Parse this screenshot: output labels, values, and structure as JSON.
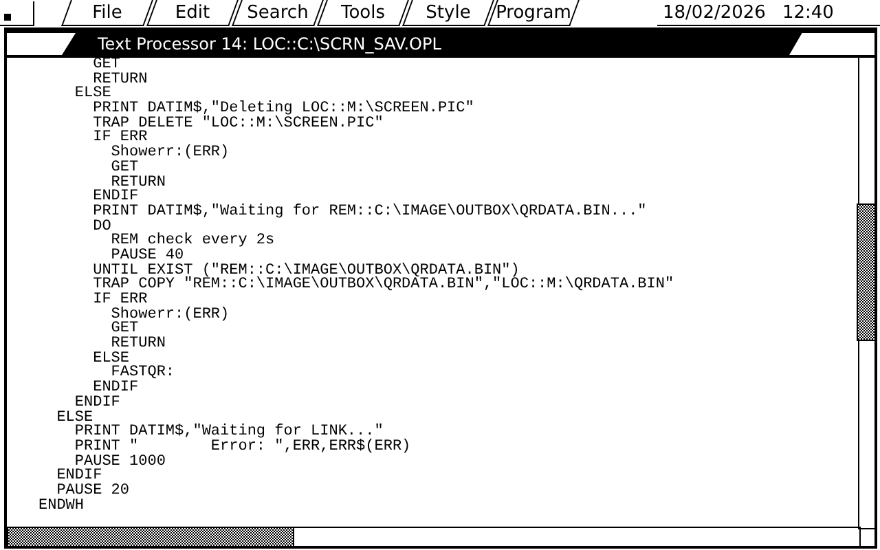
{
  "menu_bar": {
    "items": [
      "File",
      "Edit",
      "Search",
      "Tools",
      "Style",
      "Program"
    ]
  },
  "clock": {
    "date": "18/02/2026",
    "time": "12:40"
  },
  "window": {
    "title": "Text Processor 14: LOC::C:\\SCRN_SAV.OPL"
  },
  "editor": {
    "lines": [
      "      GET",
      "      RETURN",
      "    ELSE",
      "      PRINT DATIM$,\"Deleting LOC::M:\\SCREEN.PIC\"",
      "      TRAP DELETE \"LOC::M:\\SCREEN.PIC\"",
      "      IF ERR",
      "        Showerr:(ERR)",
      "        GET",
      "        RETURN",
      "      ENDIF",
      "      PRINT DATIM$,\"Waiting for REM::C:\\IMAGE\\OUTBOX\\QRDATA.BIN...\"",
      "      DO",
      "        REM check every 2s",
      "        PAUSE 40",
      "      UNTIL EXIST (\"REM::C:\\IMAGE\\OUTBOX\\QRDATA.BIN\")",
      "      TRAP COPY \"REM::C:\\IMAGE\\OUTBOX\\QRDATA.BIN\",\"LOC::M:\\QRDATA.BIN\"",
      "      IF ERR",
      "        Showerr:(ERR)",
      "        GET",
      "        RETURN",
      "      ELSE",
      "        FASTQR:",
      "      ENDIF",
      "    ENDIF",
      "  ELSE",
      "    PRINT DATIM$,\"Waiting for LINK...\"",
      "    PRINT \"        Error: \",ERR,ERR$(ERR)",
      "    PAUSE 1000",
      "  ENDIF",
      "  PAUSE 20",
      "ENDWH"
    ]
  }
}
